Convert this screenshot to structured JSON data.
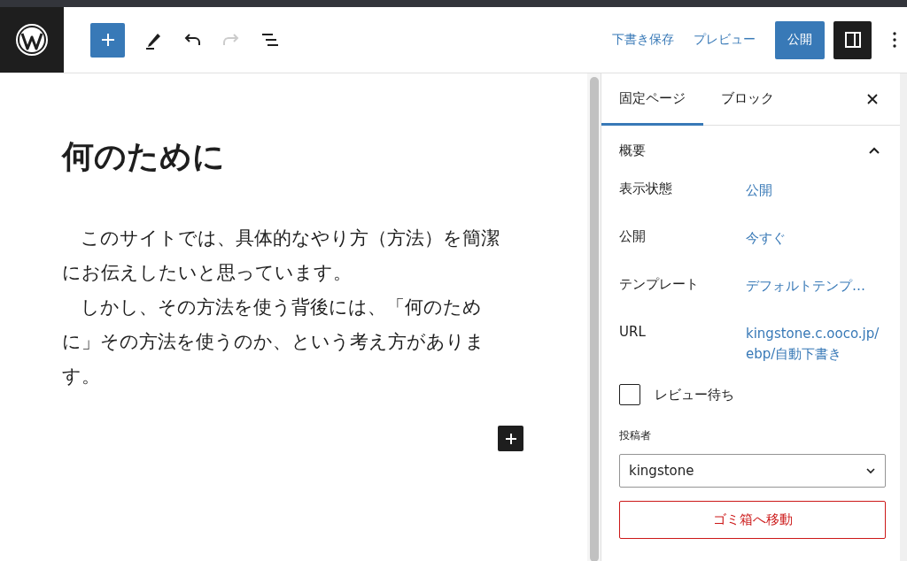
{
  "toolbar": {
    "save_draft": "下書き保存",
    "preview": "プレビュー",
    "publish": "公開",
    "settings_open": true
  },
  "editor": {
    "title": "何のために",
    "paragraphs": [
      "このサイトでは、具体的なやり方（方法）を簡潔にお伝えしたいと思っています。",
      "しかし、その方法を使う背後には、「何のために」その方法を使うのか、という考え方があります。"
    ]
  },
  "sidebar": {
    "tabs": [
      {
        "label": "固定ページ",
        "selected": true
      },
      {
        "label": "ブロック",
        "selected": false
      }
    ],
    "panel": {
      "title": "概要",
      "expanded": true,
      "rows": [
        {
          "label": "表示状態",
          "value": "公開"
        },
        {
          "label": "公開",
          "value": "今すぐ"
        },
        {
          "label": "テンプレート",
          "value": "デフォルトテンプ…"
        },
        {
          "label": "URL",
          "value": "kingstone.c.ooco.jp/ebp/自動下書き"
        }
      ],
      "review": {
        "label": "レビュー待ち",
        "checked": false
      },
      "author": {
        "label": "投稿者",
        "value": "kingstone"
      },
      "trash": "ゴミ箱へ移動"
    }
  }
}
